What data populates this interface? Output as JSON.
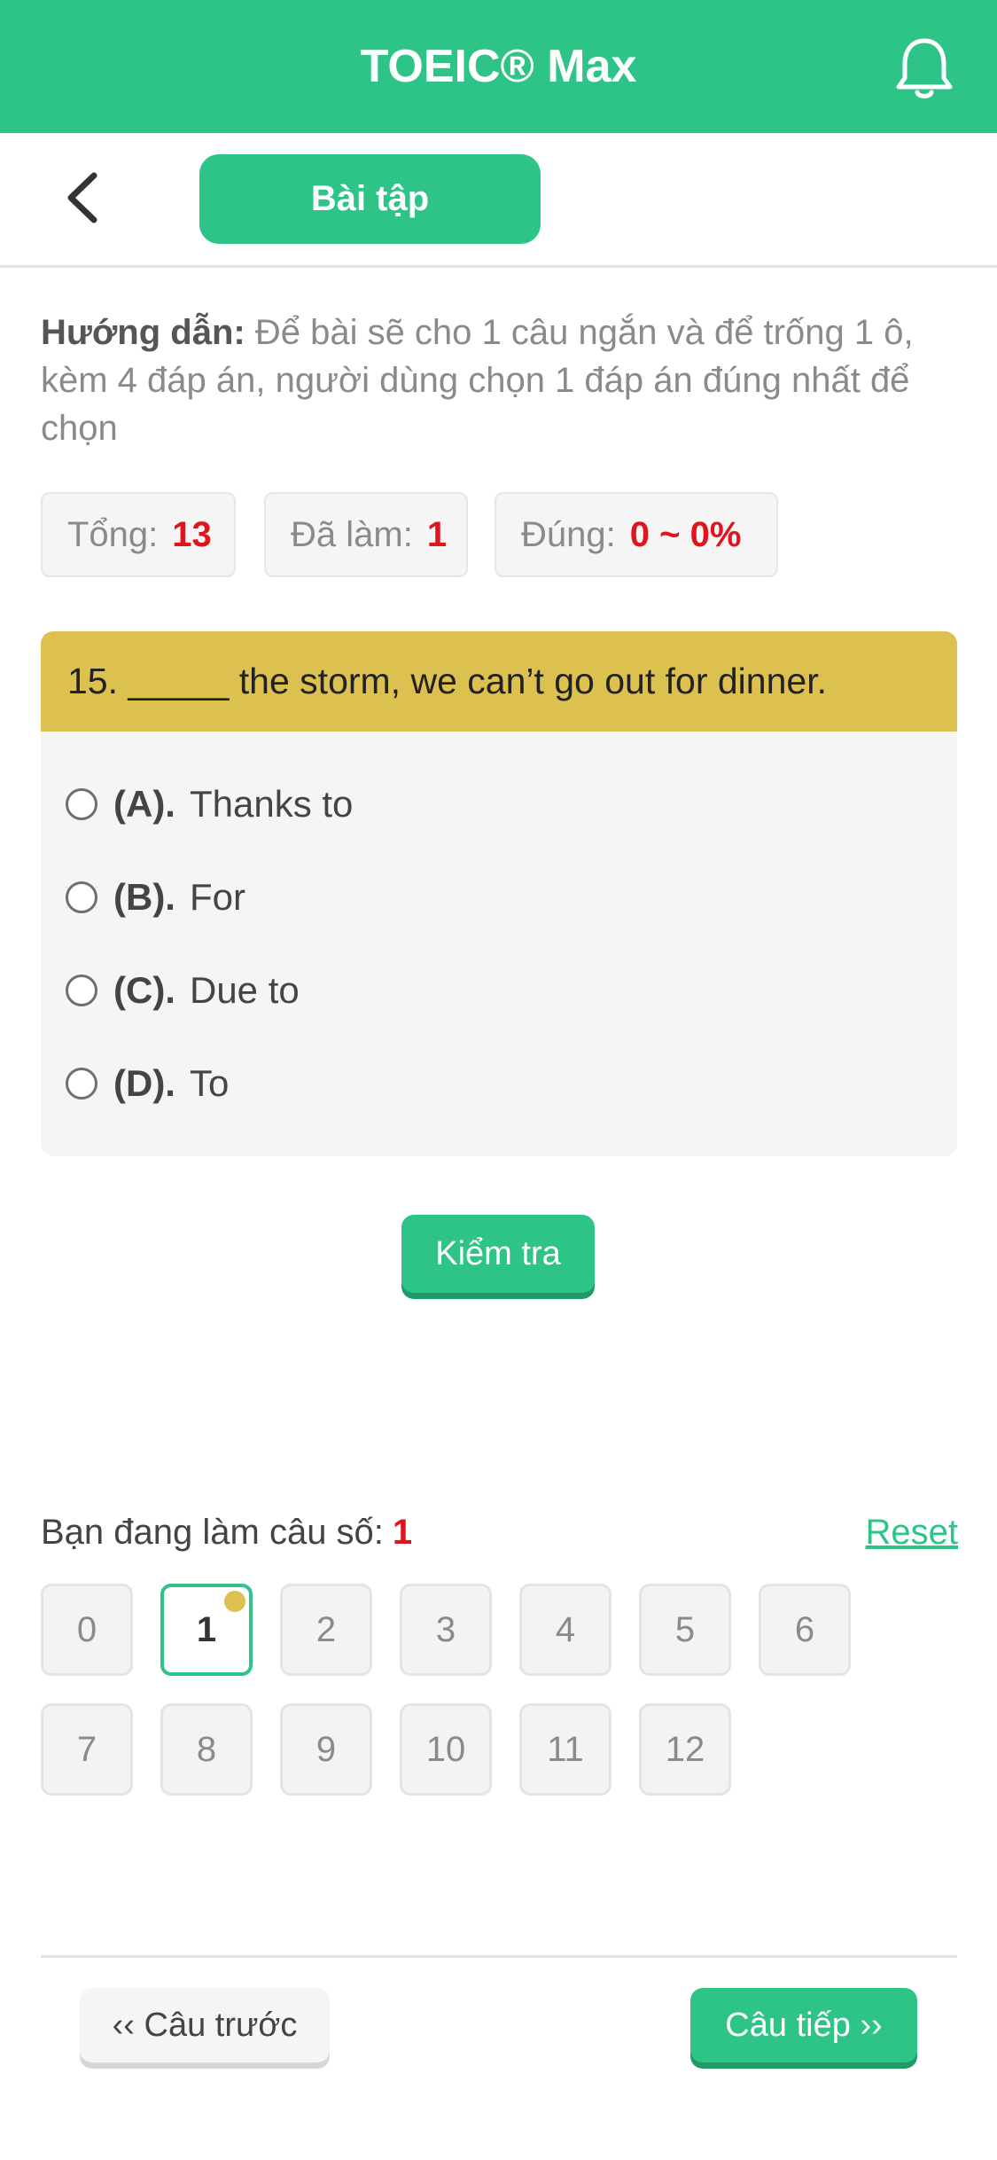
{
  "header": {
    "title": "TOEIC® Max"
  },
  "subnav": {
    "tab_label": "Bài tập"
  },
  "guide": {
    "label": "Hướng dẫn:",
    "text": "Để bài sẽ cho 1 câu ngắn và để trống 1 ô, kèm 4 đáp án, người dùng chọn 1 đáp án đúng nhất để chọn"
  },
  "stats": {
    "total_label": "Tổng:",
    "total_value": "13",
    "done_label": "Đã làm:",
    "done_value": "1",
    "correct_label": "Đúng:",
    "correct_value": "0 ~ 0%"
  },
  "question": {
    "text": "15. _____ the storm, we can’t go out for dinner.",
    "options": [
      {
        "key": "(A).",
        "text": "Thanks to"
      },
      {
        "key": "(B).",
        "text": "For"
      },
      {
        "key": "(C).",
        "text": "Due to"
      },
      {
        "key": "(D).",
        "text": "To"
      }
    ]
  },
  "check_button": "Kiểm tra",
  "progress": {
    "label": "Bạn đang làm câu số:",
    "current": "1",
    "reset_label": "Reset"
  },
  "question_grid": [
    "0",
    "1",
    "2",
    "3",
    "4",
    "5",
    "6",
    "7",
    "8",
    "9",
    "10",
    "11",
    "12"
  ],
  "footer": {
    "prev_label": "‹‹ Câu trước",
    "next_label": "Câu tiếp ››"
  },
  "colors": {
    "brand": "#2ec488",
    "question_header": "#dcc050",
    "highlight_value": "#e0141e"
  }
}
